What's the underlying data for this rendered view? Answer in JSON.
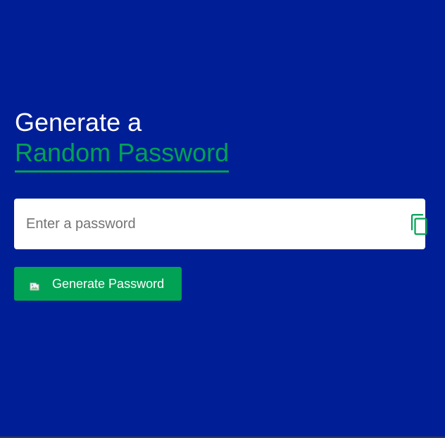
{
  "heading": {
    "line1": "Generate a",
    "line2": "Random Password"
  },
  "password": {
    "placeholder": "Enter a password",
    "value": "",
    "copy_icon": "copy-icon"
  },
  "generate": {
    "label": "Generate Password",
    "icon": "broken-image-icon"
  },
  "colors": {
    "background": "#001f97",
    "accent": "#01a254",
    "heading_text": "#ffffff",
    "input_background": "#ffffff",
    "placeholder": "#737373"
  }
}
